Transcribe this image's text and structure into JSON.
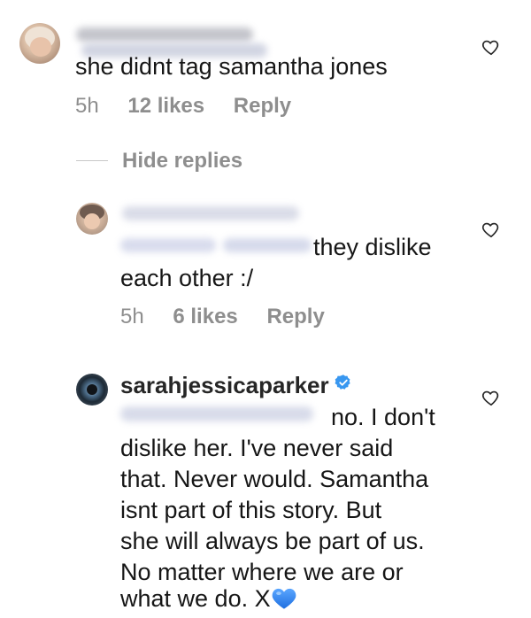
{
  "comment1": {
    "text": "she didnt tag samantha jones",
    "time": "5h",
    "likes": "12 likes",
    "reply_label": "Reply"
  },
  "hide_replies_label": "Hide replies",
  "reply1": {
    "text_line1": "they dislike",
    "text_line2": "each other :/",
    "time": "5h",
    "likes": "6 likes",
    "reply_label": "Reply"
  },
  "reply2": {
    "username": "sarahjessicaparker",
    "text_line1": "no. I don't",
    "lines": [
      "dislike her.  I've never said",
      "that. Never would. Samantha",
      "isnt part of this story. But",
      "she will always be part of us.",
      "No matter where we are or",
      "what we do. X"
    ],
    "heart_emoji": "💙"
  },
  "icons": {
    "like": "heart-outline-icon",
    "verified": "verified-badge-icon"
  },
  "colors": {
    "text": "#161616",
    "meta": "#8e8e8e",
    "verified": "#3897f0",
    "emoji_heart": "#2f7de1"
  }
}
